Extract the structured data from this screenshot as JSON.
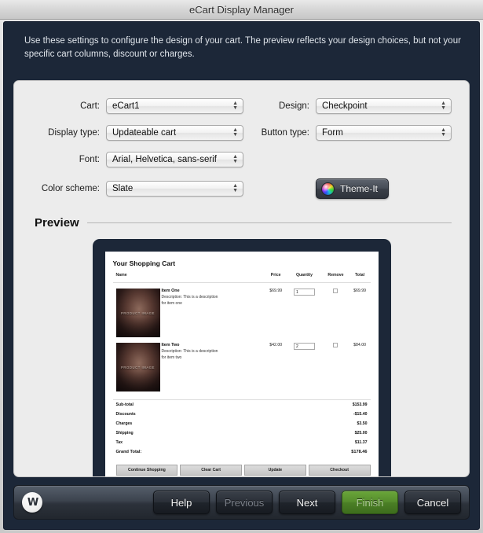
{
  "window": {
    "title": "eCart Display Manager"
  },
  "instructions": {
    "text": "Use these settings to configure the design of your cart. The preview reflects your design choices, but not your specific cart columns, discount or charges."
  },
  "form": {
    "cart": {
      "label": "Cart:",
      "value": "eCart1"
    },
    "design": {
      "label": "Design:",
      "value": "Checkpoint"
    },
    "display_type": {
      "label": "Display type:",
      "value": "Updateable cart"
    },
    "button_type": {
      "label": "Button type:",
      "value": "Form"
    },
    "font": {
      "label": "Font:",
      "value": "Arial, Helvetica, sans-serif"
    },
    "color_scheme": {
      "label": "Color scheme:",
      "value": "Slate"
    },
    "theme_button": {
      "label": "Theme-It",
      "icon": "color-wheel-icon"
    }
  },
  "preview": {
    "heading": "Preview",
    "cart": {
      "title": "Your Shopping Cart",
      "columns": [
        "Name",
        "Price",
        "Quantity",
        "Remove",
        "Total"
      ],
      "thumb_label": "PRODUCT IMAGE",
      "items": [
        {
          "name": "Item One",
          "description": "Description: This is a description for item one",
          "price": "$69.99",
          "quantity": "1",
          "total": "$69.99"
        },
        {
          "name": "Item Two",
          "description": "Description: This is a description for item two",
          "price": "$42.00",
          "quantity": "2",
          "total": "$84.00"
        }
      ],
      "totals": [
        {
          "label": "Sub-total",
          "value": "$153.99"
        },
        {
          "label": "Discounts",
          "value": "-$15.40"
        },
        {
          "label": "Charges",
          "value": "$3.50"
        },
        {
          "label": "Shipping",
          "value": "$25.00"
        },
        {
          "label": "Tax",
          "value": "$11.37"
        }
      ],
      "grand_total": {
        "label": "Grand Total:",
        "value": "$178.46"
      },
      "buttons": [
        "Continue Shopping",
        "Clear Cart",
        "Update",
        "Checkout"
      ]
    }
  },
  "footer": {
    "logo": "W",
    "help": "Help",
    "previous": "Previous",
    "next": "Next",
    "finish": "Finish",
    "cancel": "Cancel"
  },
  "colors": {
    "dark_navy": "#1c2738",
    "panel_gray": "#ececec",
    "finish_green": "#558c2c"
  }
}
